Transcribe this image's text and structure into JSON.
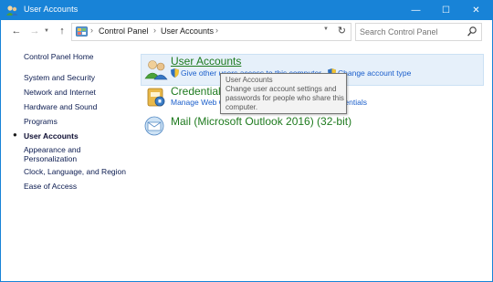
{
  "window": {
    "title": "User Accounts",
    "buttons": {
      "minimize": "—",
      "maximize": "☐",
      "close": "✕"
    },
    "accent": "#1883d7"
  },
  "navigation": {
    "back": "←",
    "forward": "→",
    "up": "↑",
    "breadcrumbs": [
      "Control Panel",
      "User Accounts"
    ],
    "refresh": "↻",
    "search_placeholder": "Search Control Panel"
  },
  "sidebar": {
    "items": [
      {
        "label": "Control Panel Home"
      },
      {
        "label": "System and Security"
      },
      {
        "label": "Network and Internet"
      },
      {
        "label": "Hardware and Sound"
      },
      {
        "label": "Programs"
      },
      {
        "label": "User Accounts",
        "current": true
      },
      {
        "label": "Appearance and Personalization"
      },
      {
        "label": "Clock, Language, and Region"
      },
      {
        "label": "Ease of Access"
      }
    ]
  },
  "main": {
    "categories": [
      {
        "title": "User Accounts",
        "icon": "user-accounts-icon",
        "links": [
          "Give other users access to this computer",
          "Change account type"
        ]
      },
      {
        "title": "Credential Manager",
        "icon": "credential-manager-icon",
        "links": [
          "Manage Web Credentials",
          "Manage Windows Credentials"
        ]
      },
      {
        "title": "Mail (Microsoft Outlook 2016) (32-bit)",
        "icon": "mail-icon",
        "links": []
      }
    ],
    "tooltip": {
      "title": "User Accounts",
      "body": "Change user account settings and passwords for people who share this computer."
    }
  }
}
